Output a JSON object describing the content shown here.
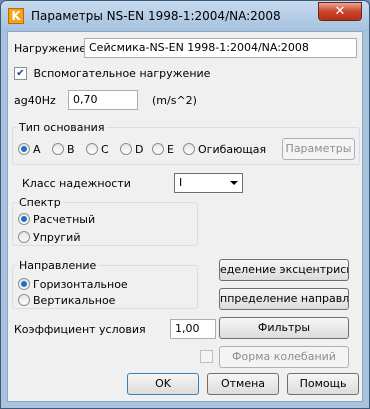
{
  "window": {
    "title": "Параметры NS-EN 1998-1:2004/NA:2008",
    "icon_letter": "K",
    "close_glyph": "✕"
  },
  "load": {
    "label": "Нагружение:",
    "value": "Сейсмика-NS-EN 1998-1:2004/NA:2008"
  },
  "auxiliary": {
    "label": "Вспомогательное нагружение",
    "checked": true
  },
  "ag": {
    "label": "ag40Hz",
    "value": "0,70",
    "unit": "(m/s^2)"
  },
  "ground_type": {
    "legend": "Тип основания",
    "options": [
      "A",
      "B",
      "C",
      "D",
      "E",
      "Огибающая"
    ],
    "selected": "A",
    "params_button": "Параметры"
  },
  "reliability": {
    "label": "Класс надежности",
    "value": "I"
  },
  "spectrum": {
    "legend": "Спектр",
    "options": [
      "Расчетный",
      "Упругий"
    ],
    "selected": "Расчетный"
  },
  "direction": {
    "legend": "Направление",
    "options": [
      "Горизонтальное",
      "Вертикальное"
    ],
    "selected": "Горизонтальное",
    "eccentricity_button": "еделение эксцентрисите",
    "direction_button": "ппределение направлени"
  },
  "coefficient": {
    "label": "Коэффициент условия",
    "value": "1,00",
    "filters_button": "Фильтры"
  },
  "mode_shapes": {
    "button": "Форма колебаний",
    "checked": false
  },
  "footer": {
    "ok": "OK",
    "cancel": "Отмена",
    "help": "Помощь"
  },
  "colors": {
    "accent": "#1f6fc8",
    "title_bar": "#a9c3df",
    "close": "#c8442a",
    "panel": "#f0f0f0"
  }
}
